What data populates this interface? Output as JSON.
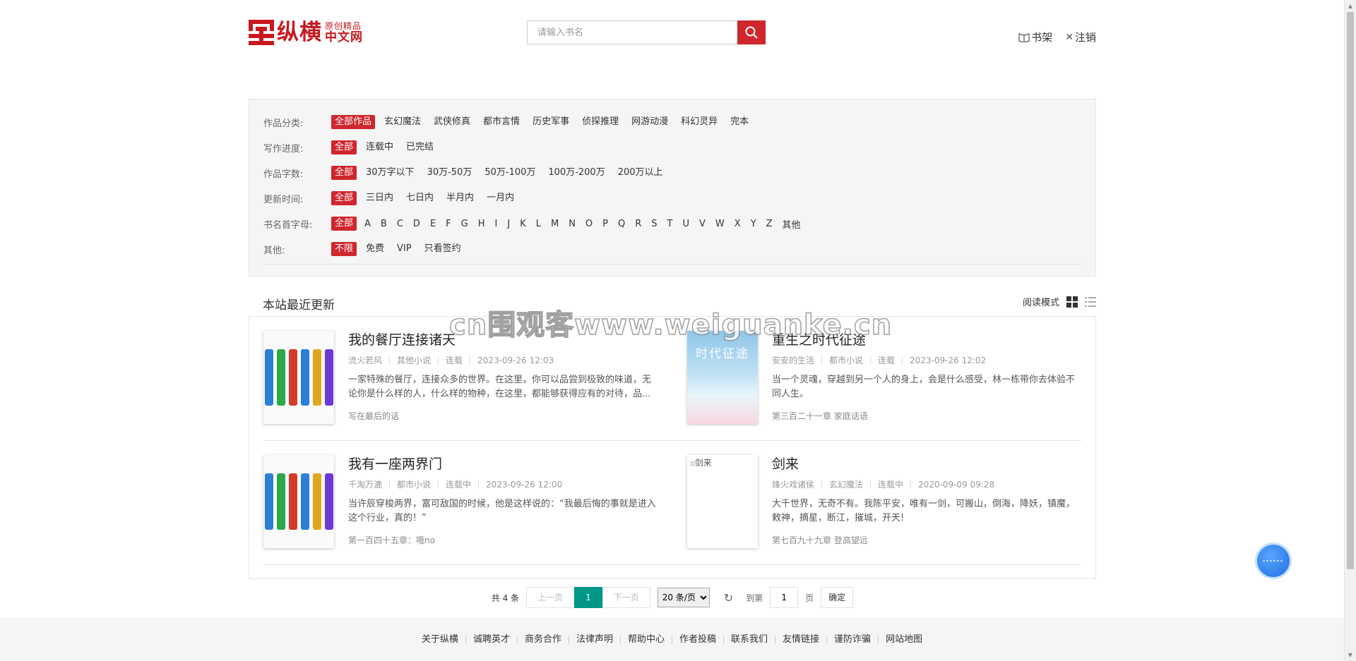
{
  "header": {
    "logo_main": "纵横",
    "logo_sub1": "原创精品",
    "logo_sub2": "中文网",
    "search_placeholder": "请输入书名",
    "bookshelf": "书架",
    "logout": "注销"
  },
  "filters": {
    "category": {
      "label": "作品分类:",
      "options": [
        "全部作品",
        "玄幻魔法",
        "武侠修真",
        "都市言情",
        "历史军事",
        "侦探推理",
        "网游动漫",
        "科幻灵异",
        "完本"
      ]
    },
    "progress": {
      "label": "写作进度:",
      "options": [
        "全部",
        "连载中",
        "已完结"
      ]
    },
    "words": {
      "label": "作品字数:",
      "options": [
        "全部",
        "30万字以下",
        "30万-50万",
        "50万-100万",
        "100万-200万",
        "200万以上"
      ]
    },
    "update": {
      "label": "更新时间:",
      "options": [
        "全部",
        "三日内",
        "七日内",
        "半月内",
        "一月内"
      ]
    },
    "initial": {
      "label": "书名首字母:",
      "all": "全部",
      "letters": [
        "A",
        "B",
        "C",
        "D",
        "E",
        "F",
        "G",
        "H",
        "I",
        "J",
        "K",
        "L",
        "M",
        "N",
        "O",
        "P",
        "Q",
        "R",
        "S",
        "T",
        "U",
        "V",
        "W",
        "X",
        "Y",
        "Z"
      ],
      "other": "其他"
    },
    "other": {
      "label": "其他:",
      "options": [
        "不限",
        "免费",
        "VIP",
        "只看签约"
      ]
    }
  },
  "section": {
    "title": "本站最近更新",
    "view_mode": "阅读模式"
  },
  "books": [
    {
      "title": "我的餐厅连接诸天",
      "author": "流火若风",
      "category": "其他小说",
      "status": "连载",
      "time": "2023-09-26 12:03",
      "desc": "一家特殊的餐厅，连接众多的世界。在这里，你可以品尝到极致的味道，无论你是什么样的人，什么样的物种，在这里，都能够获得应有的对待，品...",
      "latest": "写在最后的话"
    },
    {
      "title": "重生之时代征途",
      "author": "安安的生活",
      "category": "都市小说",
      "status": "连载",
      "time": "2023-09-26 12:02",
      "desc": "当一个灵魂，穿越到另一个人的身上，会是什么感受，林一栋带你去体验不同人生。",
      "latest": "第三百二十一章 家庭话语",
      "cover_text": "时代征途"
    },
    {
      "title": "我有一座两界门",
      "author": "千淘万漉",
      "category": "都市小说",
      "status": "连载中",
      "time": "2023-09-26 12:00",
      "desc": "当许辰穿梭两界，富可敌国的时候，他是这样说的：“我最后悔的事就是进入这个行业，真的！”",
      "latest": "第一百四十五章：哦no"
    },
    {
      "title": "剑来",
      "author": "烽火戏诸侯",
      "category": "玄幻魔法",
      "status": "连载中",
      "time": "2020-09-09 09:28",
      "desc": "大千世界，无奇不有。我陈平安，唯有一剑，可搬山，倒海，降妖，镇魔，敕神，摘星，断江，摧城，开天!",
      "latest": "第七百九十九章 登高望远",
      "cover_alt": "剑来"
    }
  ],
  "pager": {
    "total": "共 4 条",
    "prev": "上一页",
    "current": "1",
    "next": "下一页",
    "page_size": "20 条/页",
    "goto": "到第",
    "goto_value": "1",
    "unit": "页",
    "confirm": "确定"
  },
  "footer": [
    "关于纵横",
    "诚聘英才",
    "商务合作",
    "法律声明",
    "帮助中心",
    "作者投稿",
    "联系我们",
    "友情链接",
    "谨防诈骗",
    "网站地图"
  ],
  "watermark": "cn围观客www.weiguanke.cn",
  "colors": {
    "brand": "#d0262d",
    "pager_active": "#009688"
  }
}
